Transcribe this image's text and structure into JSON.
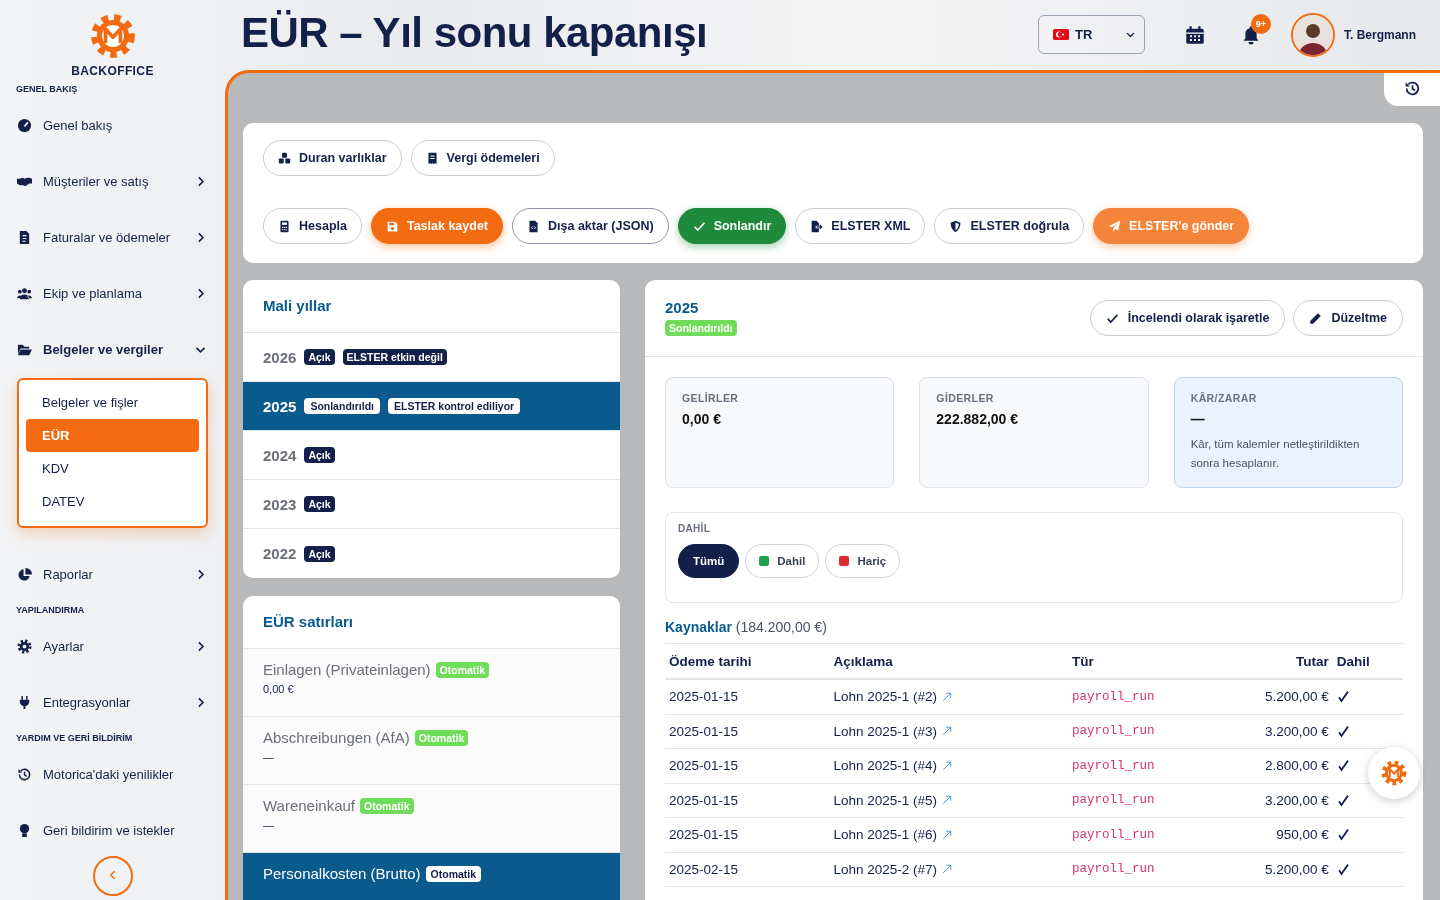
{
  "sidebar": {
    "brand": "BACKOFFICE",
    "sections": [
      {
        "heading": "GENEL BAKIŞ",
        "items": [
          {
            "label": "Genel bakış"
          },
          {
            "label": "Müşteriler ve satış",
            "expanded": false
          },
          {
            "label": "Faturalar ve ödemeler",
            "expanded": false
          },
          {
            "label": "Ekip ve planlama",
            "expanded": false
          },
          {
            "label": "Belgeler ve vergiler",
            "expanded": true,
            "children": [
              {
                "label": "Belgeler ve fişler",
                "selected": false
              },
              {
                "label": "EÜR",
                "selected": true
              },
              {
                "label": "KDV",
                "selected": false
              },
              {
                "label": "DATEV",
                "selected": false
              }
            ]
          },
          {
            "label": "Raporlar",
            "expanded": false
          }
        ]
      },
      {
        "heading": "YAPILANDIRMA",
        "items": [
          {
            "label": "Ayarlar",
            "expanded": false
          },
          {
            "label": "Entegrasyonlar",
            "expanded": false
          }
        ]
      },
      {
        "heading": "YARDIM VE GERİ BİLDİRİM",
        "items": [
          {
            "label": "Motorica'daki yenilikler"
          },
          {
            "label": "Geri bildirim ve istekler"
          }
        ]
      }
    ]
  },
  "header": {
    "title": "EÜR – Yıl sonu kapanışı",
    "language": "TR",
    "notifications": "9+",
    "user": "T. Bergmann"
  },
  "toolbar": {
    "rows": [
      [
        {
          "label": "Duran varlıklar",
          "kind": "default"
        },
        {
          "label": "Vergi ödemeleri",
          "kind": "default"
        }
      ],
      [
        {
          "label": "Hesapla",
          "kind": "default"
        },
        {
          "label": "Taslak kaydet",
          "kind": "primary"
        },
        {
          "label": "Dışa aktar (JSON)",
          "kind": "strong"
        },
        {
          "label": "Sonlandır",
          "kind": "success"
        },
        {
          "label": "ELSTER XML",
          "kind": "default"
        },
        {
          "label": "ELSTER doğrula",
          "kind": "default"
        },
        {
          "label": "ELSTER'e gönder",
          "kind": "accent"
        }
      ]
    ]
  },
  "fiscal_years": {
    "title": "Mali yıllar",
    "items": [
      {
        "year": "2026",
        "badges": [
          "Açık",
          "ELSTER etkin değil"
        ],
        "selected": false
      },
      {
        "year": "2025",
        "badges": [
          "Sonlandırıldı",
          "ELSTER kontrol ediliyor"
        ],
        "selected": true
      },
      {
        "year": "2024",
        "badges": [
          "Açık"
        ],
        "selected": false
      },
      {
        "year": "2023",
        "badges": [
          "Açık"
        ],
        "selected": false
      },
      {
        "year": "2022",
        "badges": [
          "Açık"
        ],
        "selected": false
      }
    ]
  },
  "eur_lines": {
    "title": "EÜR satırları",
    "items": [
      {
        "label": "Einlagen (Privateinlagen)",
        "badge": "Otomatik",
        "amount": "0,00 €",
        "selected": false
      },
      {
        "label": "Abschreibungen (AfA)",
        "badge": "Otomatik",
        "amount": "—",
        "selected": false
      },
      {
        "label": "Wareneinkauf",
        "badge": "Otomatik",
        "amount": "—",
        "selected": false
      },
      {
        "label": "Personalkosten (Brutto)",
        "badge": "Otomatik",
        "selected": true
      }
    ]
  },
  "detail": {
    "year": "2025",
    "status": "Sonlandırıldı",
    "buttons": [
      "İncelendi olarak işaretle",
      "Düzeltme"
    ],
    "stats": [
      {
        "label": "GELİRLER",
        "value": "0,00 €",
        "highlighted": false
      },
      {
        "label": "GİDERLER",
        "value": "222.882,00 €",
        "highlighted": false
      },
      {
        "label": "KÂR/ZARAR",
        "value": "—",
        "note": "Kâr, tüm kalemler netleştirildikten sonra hesaplanır.",
        "highlighted": true
      }
    ],
    "filter": {
      "label": "DAHİL",
      "options": [
        {
          "label": "Tümü",
          "selected": true
        },
        {
          "label": "Dahil",
          "color": "#22a04b",
          "selected": false
        },
        {
          "label": "Hariç",
          "color": "#dc2e2e",
          "selected": false
        }
      ]
    },
    "sources": {
      "title": "Kaynaklar",
      "total": "(184.200,00 €)",
      "columns": [
        "Ödeme tarihi",
        "Açıklama",
        "Tür",
        "Tutar",
        "Dahil"
      ],
      "rows": [
        {
          "date": "2025-01-15",
          "description": "Lohn 2025-1 (#2)",
          "type": "payroll_run",
          "amount": "5.200,00 €",
          "included": true
        },
        {
          "date": "2025-01-15",
          "description": "Lohn 2025-1 (#3)",
          "type": "payroll_run",
          "amount": "3.200,00 €",
          "included": true
        },
        {
          "date": "2025-01-15",
          "description": "Lohn 2025-1 (#4)",
          "type": "payroll_run",
          "amount": "2.800,00 €",
          "included": true
        },
        {
          "date": "2025-01-15",
          "description": "Lohn 2025-1 (#5)",
          "type": "payroll_run",
          "amount": "3.200,00 €",
          "included": true
        },
        {
          "date": "2025-01-15",
          "description": "Lohn 2025-1 (#6)",
          "type": "payroll_run",
          "amount": "950,00 €",
          "included": true
        },
        {
          "date": "2025-02-15",
          "description": "Lohn 2025-2 (#7)",
          "type": "payroll_run",
          "amount": "5.200,00 €",
          "included": true
        }
      ]
    }
  }
}
